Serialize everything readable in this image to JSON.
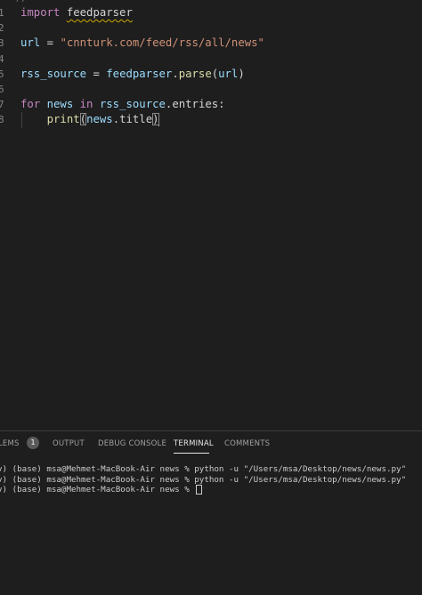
{
  "editor": {
    "partial_top": "/)",
    "lines": [
      {
        "num": "1",
        "tokens": [
          {
            "t": "import",
            "c": "kw"
          },
          {
            "t": " ",
            "c": "plain"
          },
          {
            "t": "feedparser",
            "c": "plain",
            "squiggle": true
          }
        ]
      },
      {
        "num": "2",
        "tokens": []
      },
      {
        "num": "3",
        "tokens": [
          {
            "t": "url",
            "c": "var"
          },
          {
            "t": " = ",
            "c": "plain"
          },
          {
            "t": "\"cnnturk.com/feed/rss/all/news\"",
            "c": "str"
          }
        ]
      },
      {
        "num": "4",
        "tokens": []
      },
      {
        "num": "5",
        "tokens": [
          {
            "t": "rss_source",
            "c": "var"
          },
          {
            "t": " = ",
            "c": "plain"
          },
          {
            "t": "feedparser",
            "c": "var"
          },
          {
            "t": ".",
            "c": "plain"
          },
          {
            "t": "parse",
            "c": "fn"
          },
          {
            "t": "(",
            "c": "plain"
          },
          {
            "t": "url",
            "c": "var"
          },
          {
            "t": ")",
            "c": "plain"
          }
        ]
      },
      {
        "num": "6",
        "tokens": []
      },
      {
        "num": "7",
        "tokens": [
          {
            "t": "for",
            "c": "kw"
          },
          {
            "t": " ",
            "c": "plain"
          },
          {
            "t": "news",
            "c": "var"
          },
          {
            "t": " ",
            "c": "plain"
          },
          {
            "t": "in",
            "c": "kw"
          },
          {
            "t": " ",
            "c": "plain"
          },
          {
            "t": "rss_source",
            "c": "var"
          },
          {
            "t": ".entries:",
            "c": "plain"
          }
        ]
      },
      {
        "num": "8",
        "tokens": [
          {
            "t": "    ",
            "c": "plain"
          },
          {
            "t": "print",
            "c": "fn"
          },
          {
            "t": "(",
            "c": "plain",
            "hl": true
          },
          {
            "t": "news",
            "c": "var"
          },
          {
            "t": ".title",
            "c": "plain"
          },
          {
            "t": ")",
            "c": "plain",
            "hl": true,
            "cursor": true
          }
        ]
      }
    ]
  },
  "panel": {
    "tabs": [
      {
        "label": "LEMS",
        "active": false
      },
      {
        "label": "OUTPUT",
        "active": false
      },
      {
        "label": "DEBUG CONSOLE",
        "active": false
      },
      {
        "label": "TERMINAL",
        "active": true
      },
      {
        "label": "COMMENTS",
        "active": false
      }
    ],
    "problems_badge": "1",
    "terminal_lines": [
      "v) (base) msa@Mehmet-MacBook-Air news % python -u \"/Users/msa/Desktop/news/news.py\"",
      "v) (base) msa@Mehmet-MacBook-Air news % python -u \"/Users/msa/Desktop/news/news.py\"",
      "v) (base) msa@Mehmet-MacBook-Air news % "
    ]
  }
}
